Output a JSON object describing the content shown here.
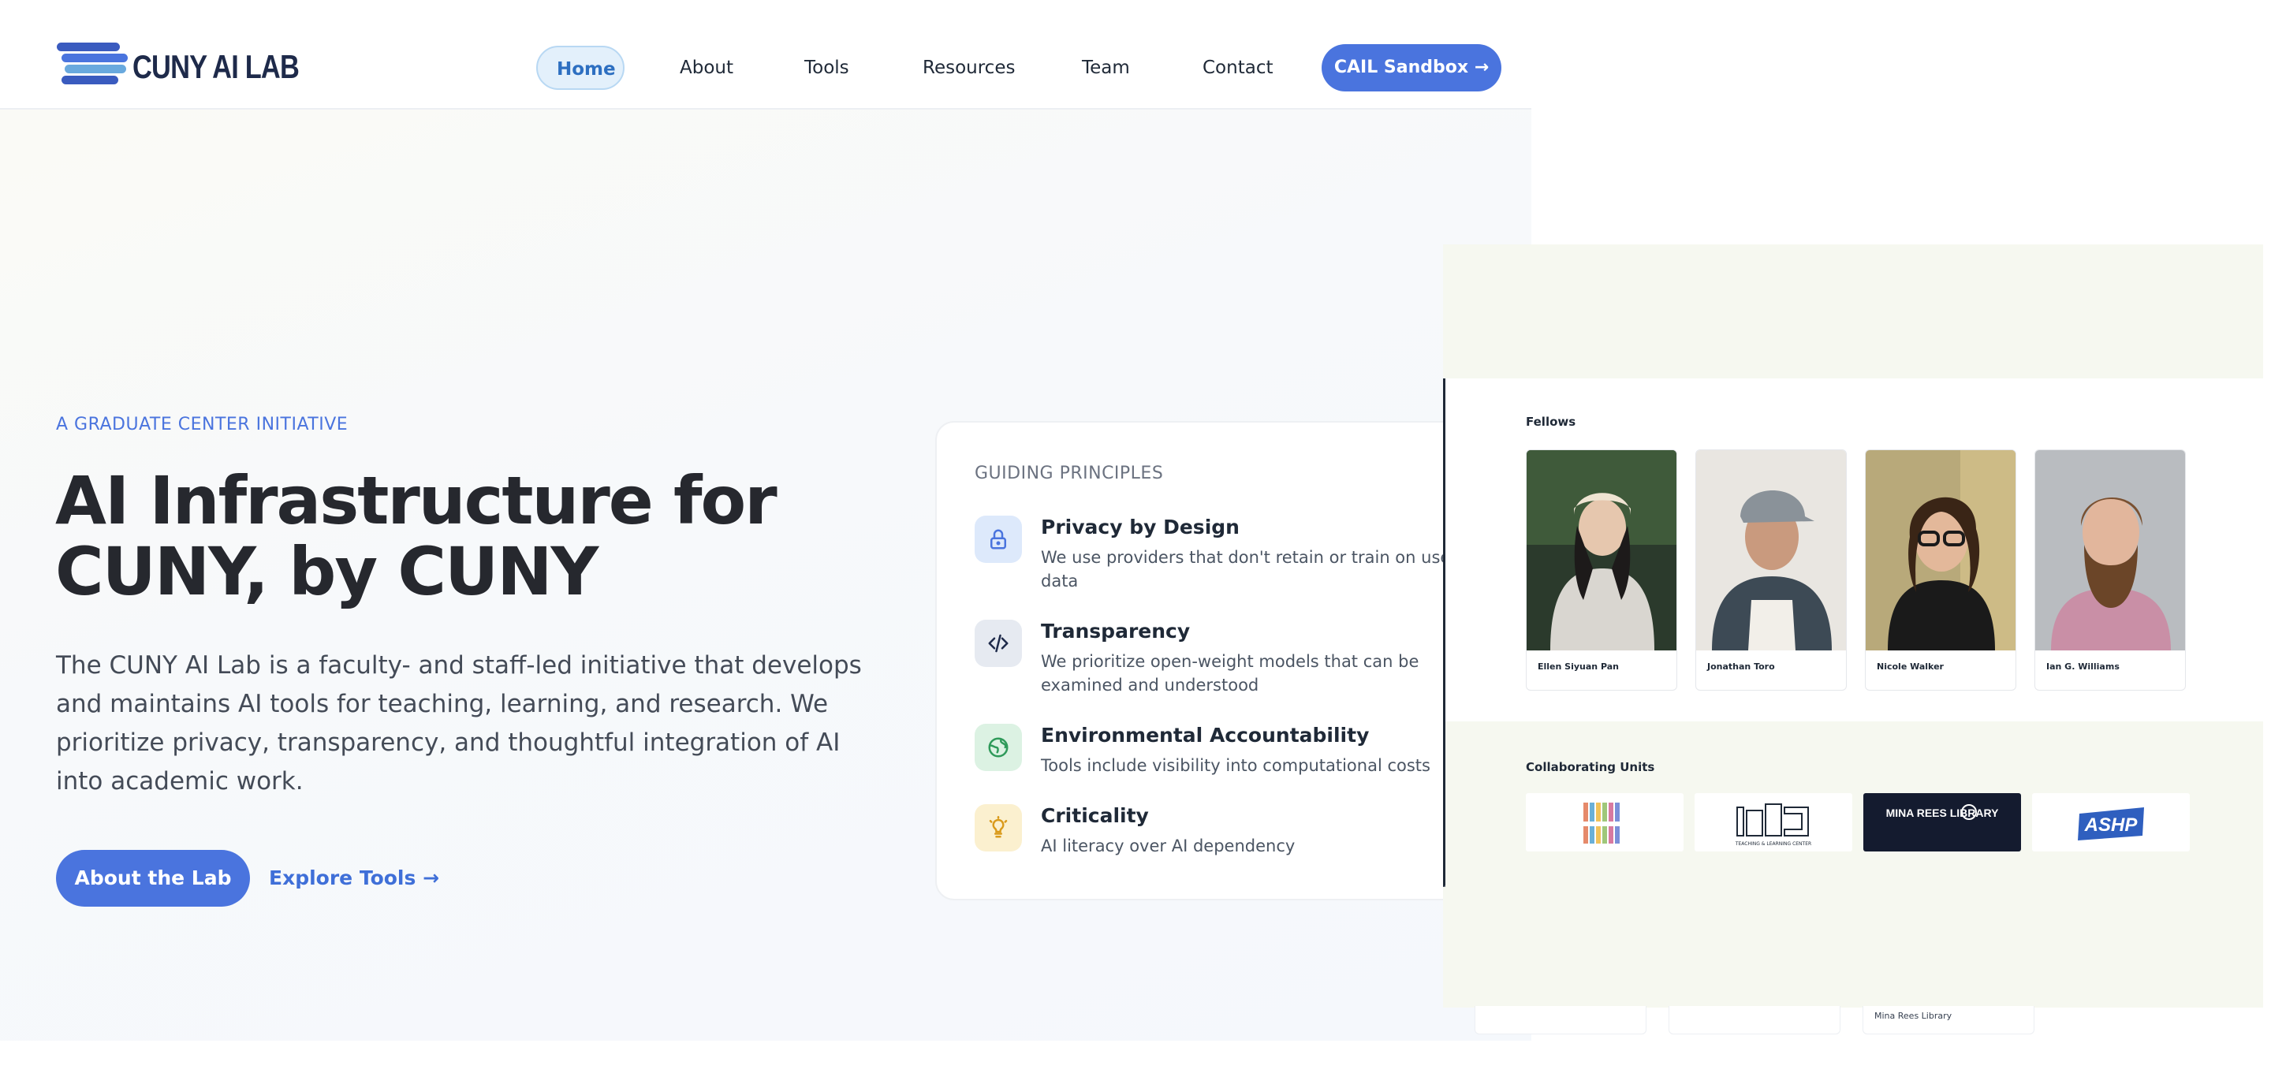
{
  "navbar": {
    "brand": "CUNY AI LAB",
    "links": [
      "Home",
      "About",
      "Tools",
      "Resources",
      "Team",
      "Contact"
    ],
    "active": "Home",
    "cta": "CAIL Sandbox →"
  },
  "hero": {
    "eyebrow": "A GRADUATE CENTER INITIATIVE",
    "title_line1": "AI Infrastructure for",
    "title_line2": "CUNY, by CUNY",
    "description": "The CUNY AI Lab is a faculty- and staff-led initiative that develops and maintains AI tools for teaching, learning, and research. We prioritize privacy, transparency, and thoughtful integration of AI into academic work.",
    "primary_button": "About the Lab",
    "secondary_link": "Explore Tools →"
  },
  "principles": {
    "heading": "GUIDING PRINCIPLES",
    "items": [
      {
        "title": "Privacy by Design",
        "description": "We use providers that don't retain or train on user data",
        "icon": "lock-icon",
        "color": "#4a74de"
      },
      {
        "title": "Transparency",
        "description": "We prioritize open-weight models that can be examined and understood",
        "icon": "code-icon",
        "color": "#1e2a4a"
      },
      {
        "title": "Environmental Accountability",
        "description": "Tools include visibility into computational costs",
        "icon": "globe-icon",
        "color": "#2f9a5a"
      },
      {
        "title": "Criticality",
        "description": "AI literacy over AI dependency",
        "icon": "lightbulb-icon",
        "color": "#d99a1b"
      }
    ]
  },
  "overlay": {
    "fellows_heading": "Fellows",
    "fellows": [
      "Ellen Siyuan Pan",
      "Jonathan Toro",
      "Nicole Walker",
      "Ian G. Williams"
    ],
    "units_heading": "Collaborating Units",
    "units": [
      {
        "name": "stripes-logo"
      },
      {
        "name": "tlc-logo",
        "text": "TEACHING & LEARNING CENTER"
      },
      {
        "name": "mina-rees-logo",
        "text": "MINA REES LIBRARY"
      },
      {
        "name": "ashp-logo",
        "text": "ASHP"
      }
    ],
    "under_label": "Mina Rees Library"
  },
  "colors": {
    "accent": "#4a74de",
    "brand_dark": "#1e2a4a",
    "heading": "#26282e"
  }
}
